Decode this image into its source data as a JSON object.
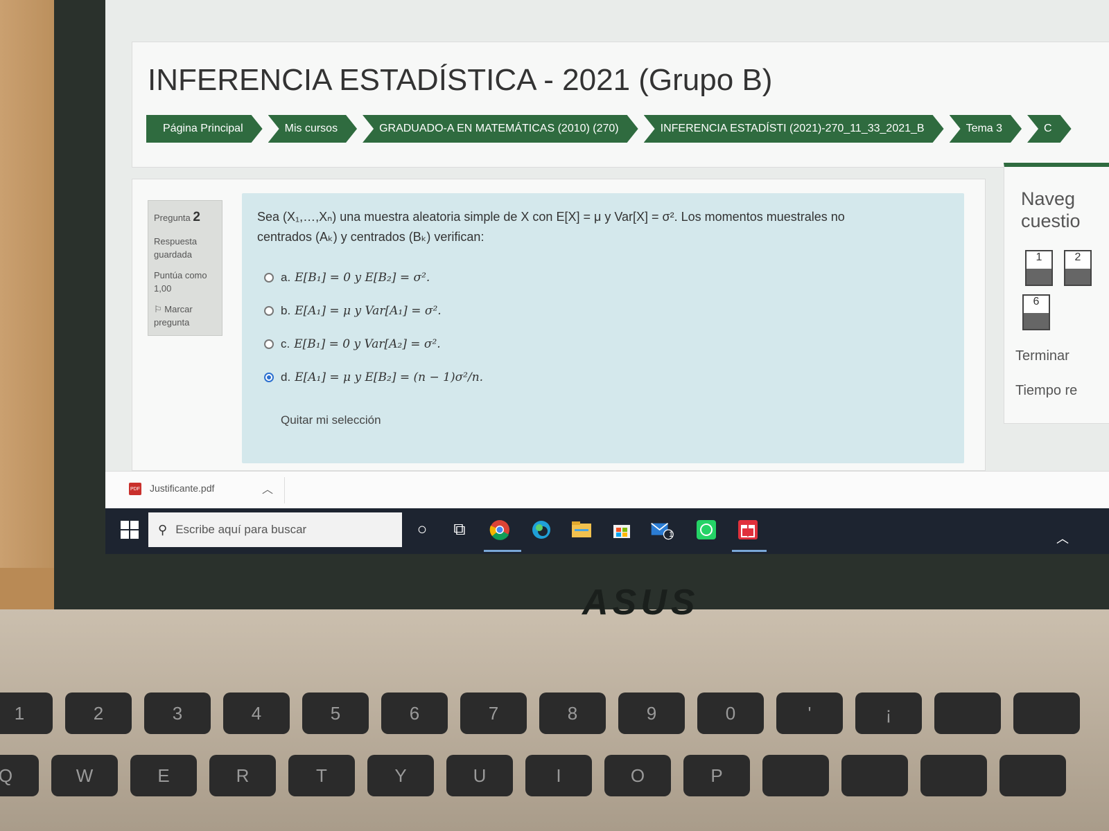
{
  "course": {
    "title": "INFERENCIA ESTADÍSTICA - 2021 (Grupo B)"
  },
  "breadcrumb": [
    {
      "label": "Página Principal"
    },
    {
      "label": "Mis cursos"
    },
    {
      "label": "GRADUADO-A EN MATEMÁTICAS (2010) (270)"
    },
    {
      "label": "INFERENCIA ESTADÍSTI (2021)-270_11_33_2021_B"
    },
    {
      "label": "Tema 3"
    },
    {
      "label": "C"
    }
  ],
  "question_info": {
    "label": "Pregunta",
    "number": "2",
    "status": "Respuesta guardada",
    "score": "Puntúa como 1,00",
    "flag": "Marcar pregunta"
  },
  "question": {
    "text_line1": "Sea (X₁,…,Xₙ) una muestra aleatoria simple de X con E[X] = μ y Var[X] = σ². Los momentos muestrales no",
    "text_line2": "centrados (Aₖ) y centrados (Bₖ) verifican:",
    "options": [
      {
        "letter": "a.",
        "text": "E[B₁] = 0 y E[B₂] = σ².",
        "selected": false
      },
      {
        "letter": "b.",
        "text": "E[A₁] = μ y Var[A₁] = σ².",
        "selected": false
      },
      {
        "letter": "c.",
        "text": "E[B₁] = 0 y Var[A₂] = σ².",
        "selected": false
      },
      {
        "letter": "d.",
        "text": "E[A₁] = μ y E[B₂] = (n − 1)σ²/n.",
        "selected": true
      }
    ],
    "clear_label": "Quitar mi selección"
  },
  "nav": {
    "title_line1": "Naveg",
    "title_line2": "cuestio",
    "buttons": [
      "1",
      "2",
      "6"
    ],
    "finish": "Terminar",
    "time": "Tiempo re"
  },
  "download": {
    "filename": "Justificante.pdf",
    "icon": "pdf-icon"
  },
  "taskbar": {
    "search_placeholder": "Escribe aquí para buscar",
    "mail_badge": "1"
  },
  "laptop": {
    "brand": "ASUS"
  },
  "colors": {
    "accent_green": "#2f6b3f",
    "question_bg": "#d4e8ec",
    "radio_selected": "#2b6fcf"
  }
}
